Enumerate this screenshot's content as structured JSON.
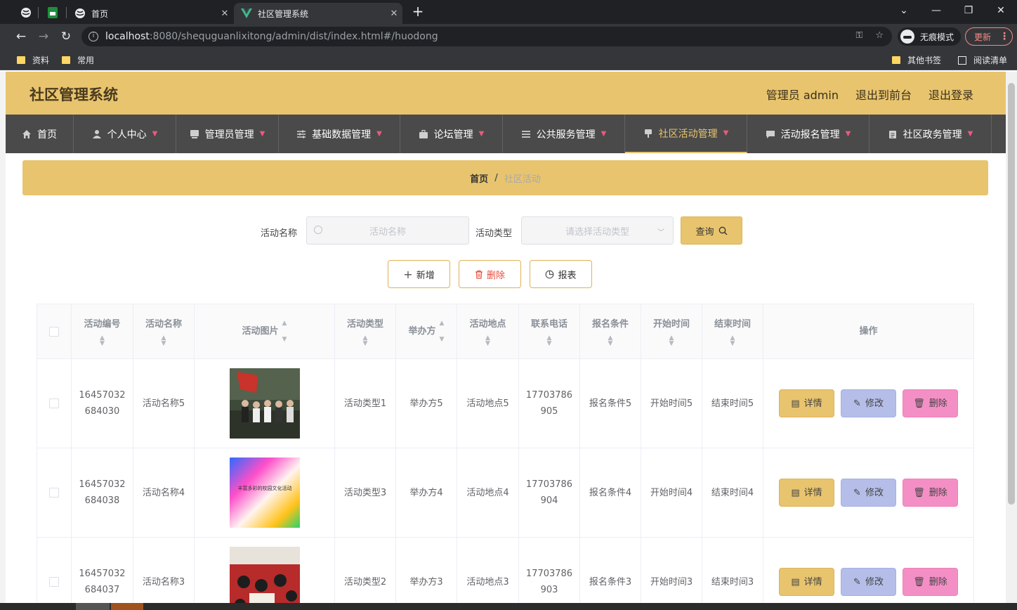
{
  "browser": {
    "tabs": [
      {
        "title": "首页"
      },
      {
        "title": "社区管理系统",
        "active": true
      }
    ],
    "new_tab": "+",
    "window_controls": [
      "⌄",
      "—",
      "❐",
      "✕"
    ],
    "url_host": "localhost",
    "url_path": ":8080/shequguanlixitong/admin/dist/index.html#/huodong",
    "incognito_label": "无痕模式",
    "update_label": "更新",
    "bookmarks": [
      "资料",
      "常用"
    ],
    "other_bookmarks": "其他书签",
    "reading_list": "阅读清单"
  },
  "app": {
    "title": "社区管理系统",
    "header_links": [
      "管理员 admin",
      "退出到前台",
      "退出登录"
    ],
    "menu": [
      {
        "label": "首页",
        "icon": "home-icon",
        "caret": false
      },
      {
        "label": "个人中心",
        "icon": "user-icon",
        "caret": true
      },
      {
        "label": "管理员管理",
        "icon": "monitor-icon",
        "caret": true
      },
      {
        "label": "基础数据管理",
        "icon": "sliders-icon",
        "caret": true
      },
      {
        "label": "论坛管理",
        "icon": "briefcase-icon",
        "caret": true
      },
      {
        "label": "公共服务管理",
        "icon": "list-icon",
        "caret": true
      },
      {
        "label": "社区活动管理",
        "icon": "flag-icon",
        "caret": true,
        "active": true
      },
      {
        "label": "活动报名管理",
        "icon": "chat-icon",
        "caret": true
      },
      {
        "label": "社区政务管理",
        "icon": "clipboard-icon",
        "caret": true
      }
    ],
    "breadcrumb": {
      "home": "首页",
      "separator": "/",
      "current": "社区活动"
    },
    "search": {
      "name_label": "活动名称",
      "name_placeholder": "活动名称",
      "type_label": "活动类型",
      "type_placeholder": "请选择活动类型",
      "query_label": "查询"
    },
    "actions": {
      "add": "新增",
      "delete": "删除",
      "report": "报表"
    },
    "table": {
      "headers": [
        "活动编号",
        "活动名称",
        "活动图片",
        "活动类型",
        "举办方",
        "活动地点",
        "联系电话",
        "报名条件",
        "开始时间",
        "结束时间",
        "操作"
      ],
      "rows": [
        {
          "id": "16457032684030",
          "id_l1": "16457032",
          "id_l2": "684030",
          "name": "活动名称5",
          "image": "group-photo",
          "type": "活动类型1",
          "host": "举办方5",
          "place": "活动地点5",
          "phone_l1": "17703786",
          "phone_l2": "905",
          "cond": "报名条件5",
          "start": "开始时间5",
          "end": "结束时间5"
        },
        {
          "id": "16457032684038",
          "id_l1": "16457032",
          "id_l2": "684038",
          "name": "活动名称4",
          "image": "campus-culture-poster",
          "image_text": "丰富多彩的校园文化活动",
          "type": "活动类型3",
          "host": "举办方4",
          "place": "活动地点4",
          "phone_l1": "17703786",
          "phone_l2": "904",
          "cond": "报名条件4",
          "start": "开始时间4",
          "end": "结束时间4"
        },
        {
          "id": "16457032684037",
          "id_l1": "16457032",
          "id_l2": "684037",
          "name": "活动名称3",
          "image": "classroom-photo",
          "type": "活动类型2",
          "host": "举办方3",
          "place": "活动地点3",
          "phone_l1": "17703786",
          "phone_l2": "903",
          "cond": "报名条件3",
          "start": "开始时间3",
          "end": "结束时间3"
        }
      ],
      "op_labels": {
        "detail": "详情",
        "edit": "修改",
        "delete": "删除"
      }
    },
    "colors": {
      "accent": "#e8c46e",
      "menu_bg": "#4a4a4a",
      "edit_btn": "#b5bee9",
      "delete_btn": "#f48fc6"
    }
  }
}
